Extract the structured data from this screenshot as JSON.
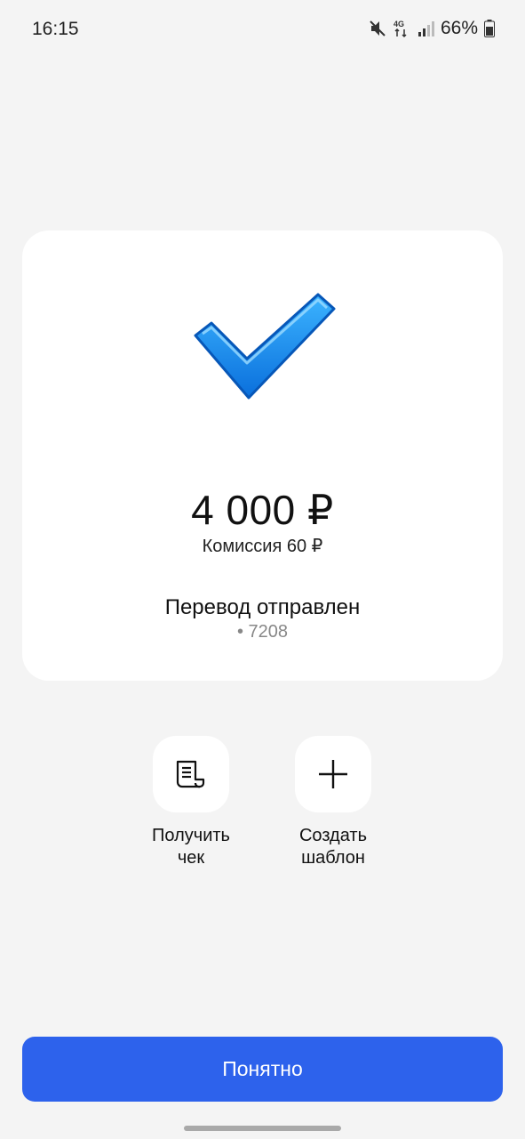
{
  "status_bar": {
    "time": "16:15",
    "network_label": "4G",
    "battery_percent": "66%",
    "icons": [
      "mute-icon",
      "network-4g-icon",
      "signal-icon",
      "battery-icon"
    ]
  },
  "result": {
    "amount": "4 000 ₽",
    "commission": "Комиссия 60 ₽",
    "title": "Перевод отправлен",
    "card_number": "• 7208",
    "icon": "check-icon"
  },
  "actions": [
    {
      "label": "Получить\nчек",
      "icon": "receipt-icon"
    },
    {
      "label": "Создать\nшаблон",
      "icon": "plus-icon"
    }
  ],
  "primary_button": {
    "label": "Понятно"
  },
  "colors": {
    "background": "#f4f4f4",
    "card": "#ffffff",
    "accent": "#2d62ec",
    "check": "#1a8cf0",
    "secondary_text": "#888888"
  }
}
